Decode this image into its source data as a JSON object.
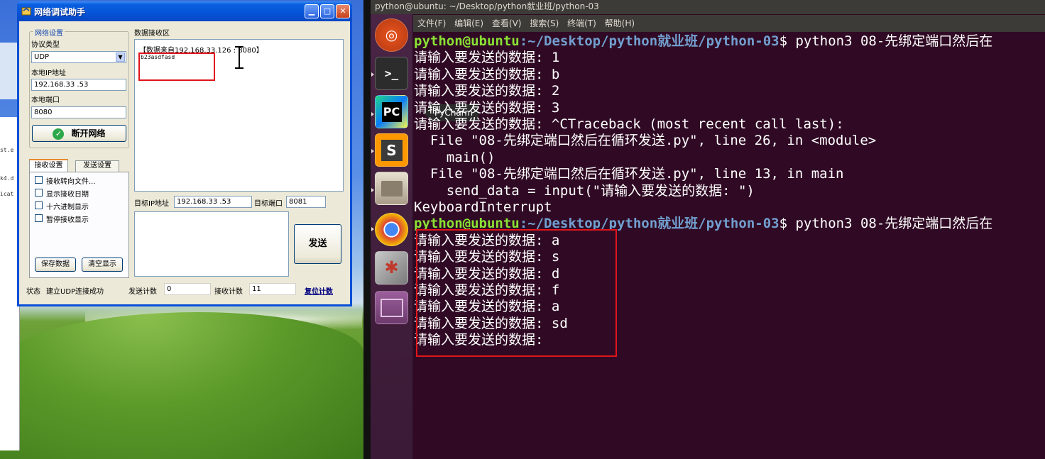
{
  "xp_window": {
    "title": "网络调试助手",
    "network_settings": {
      "group_label": "网络设置",
      "protocol_label": "协议类型",
      "protocol_value": "UDP",
      "local_ip_label": "本地IP地址",
      "local_ip_value": "192.168.33 .53",
      "local_port_label": "本地端口",
      "local_port_value": "8080",
      "disconnect_button": "断开网络"
    },
    "receive_area": {
      "label": "数据接收区",
      "line1": "【数据来自192.168.33.126 : 8080】",
      "line2": "b23asdfasd"
    },
    "tabs": {
      "receive_settings": "接收设置",
      "send_settings": "发送设置"
    },
    "receive_options": [
      "接收转向文件...",
      "显示接收日期",
      "十六进制显示",
      "暂停接收显示"
    ],
    "buttons": {
      "save_data": "保存数据",
      "clear_display": "清空显示",
      "send": "发送",
      "reset_count": "复位计数"
    },
    "target": {
      "ip_label": "目标IP地址",
      "ip_value": "192.168.33 .53",
      "port_label": "目标端口",
      "port_value": "8081"
    },
    "status": {
      "label": "状态",
      "text": "建立UDP连接成功",
      "send_count_label": "发送计数",
      "send_count": "0",
      "receive_count_label": "接收计数",
      "receive_count": "11"
    }
  },
  "background_window_fragments": [
    "st.e",
    "k4.d",
    "icat"
  ],
  "ubuntu": {
    "window_title": "python@ubuntu: ~/Desktop/python就业班/python-03",
    "menu": [
      "文件(F)",
      "编辑(E)",
      "查看(V)",
      "搜索(S)",
      "终端(T)",
      "帮助(H)"
    ],
    "launcher_tooltip": "PyCharm",
    "launcher_icons": [
      "ubuntu-dash-icon",
      "terminal-icon",
      "pycharm-icon",
      "sublime-text-icon",
      "file-manager-icon",
      "chrome-icon",
      "system-settings-icon",
      "workspace-switcher-icon"
    ]
  },
  "terminal": {
    "prompt_user": "python@ubuntu",
    "prompt_path": ":~/Desktop/python就业班/python-03",
    "lines": [
      {
        "type": "prompt",
        "cmd": "$ python3 08-先绑定端口然后在"
      },
      {
        "type": "text",
        "text": "请输入要发送的数据: 1"
      },
      {
        "type": "text",
        "text": "请输入要发送的数据: b"
      },
      {
        "type": "text",
        "text": "请输入要发送的数据: 2"
      },
      {
        "type": "text",
        "text": "请输入要发送的数据: 3"
      },
      {
        "type": "text",
        "text": "请输入要发送的数据: ^CTraceback (most recent call last):"
      },
      {
        "type": "text",
        "text": "  File \"08-先绑定端口然后在循环发送.py\", line 26, in <module>"
      },
      {
        "type": "text",
        "text": "    main()"
      },
      {
        "type": "text",
        "text": "  File \"08-先绑定端口然后在循环发送.py\", line 13, in main"
      },
      {
        "type": "text",
        "text": "    send_data = input(\"请输入要发送的数据: \")"
      },
      {
        "type": "text",
        "text": "KeyboardInterrupt"
      },
      {
        "type": "prompt",
        "cmd": "$ python3 08-先绑定端口然后在"
      },
      {
        "type": "text",
        "text": "请输入要发送的数据: a"
      },
      {
        "type": "text",
        "text": "请输入要发送的数据: s"
      },
      {
        "type": "text",
        "text": "请输入要发送的数据: d"
      },
      {
        "type": "text",
        "text": "请输入要发送的数据: f"
      },
      {
        "type": "text",
        "text": "请输入要发送的数据: a"
      },
      {
        "type": "text",
        "text": "请输入要发送的数据: sd"
      },
      {
        "type": "text",
        "text": "请输入要发送的数据: "
      }
    ]
  },
  "colors": {
    "annotation_red": "#e0151b",
    "terminal_bg": "#300a24",
    "prompt_green": "#8ae234",
    "prompt_blue": "#729fcf"
  }
}
